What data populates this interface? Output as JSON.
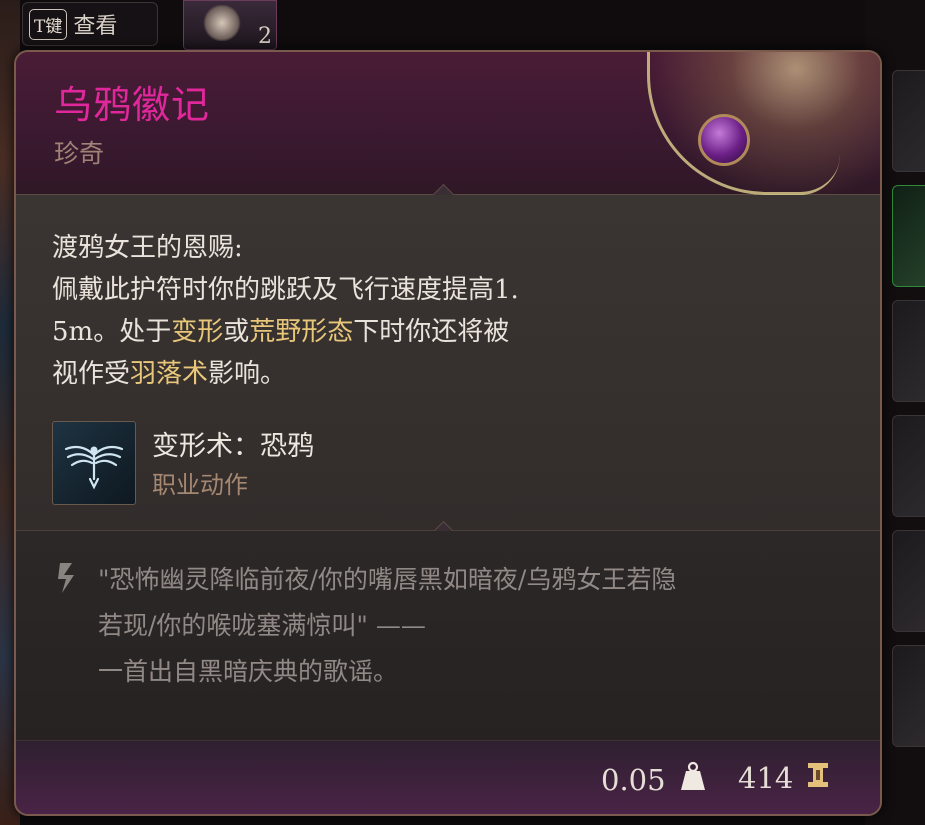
{
  "hotkey": {
    "key_label": "T键",
    "action_label": "查看"
  },
  "top_item": {
    "quantity": "2"
  },
  "tooltip": {
    "item_name": "乌鸦徽记",
    "rarity": "珍奇",
    "rarity_color": "#e0279b",
    "description": {
      "title": "渡鸦女王的恩赐:",
      "line1": "佩戴此护符时你的跳跃及飞行速度提高1.",
      "line2_a": "5m。处于",
      "line2_hl1": "变形",
      "line2_b": "或",
      "line2_hl2": "荒野形态",
      "line2_c": "下时你还将被",
      "line3_a": "视作受",
      "line3_hl": "羽落术",
      "line3_b": "影响。"
    },
    "granted_action": {
      "name": "变形术：恐鸦",
      "type": "职业动作",
      "icon": "raven-wings-icon"
    },
    "lore": {
      "line1": "\"恐怖幽灵降临前夜/你的嘴唇黑如暗夜/乌鸦女王若隐",
      "line2": "若现/你的喉咙塞满惊叫\" ——",
      "line3": "一首出自黑暗庆典的歌谣。"
    },
    "footer": {
      "weight": "0.05",
      "weight_icon": "weight-icon",
      "value": "414",
      "value_icon": "gold-icon"
    }
  }
}
